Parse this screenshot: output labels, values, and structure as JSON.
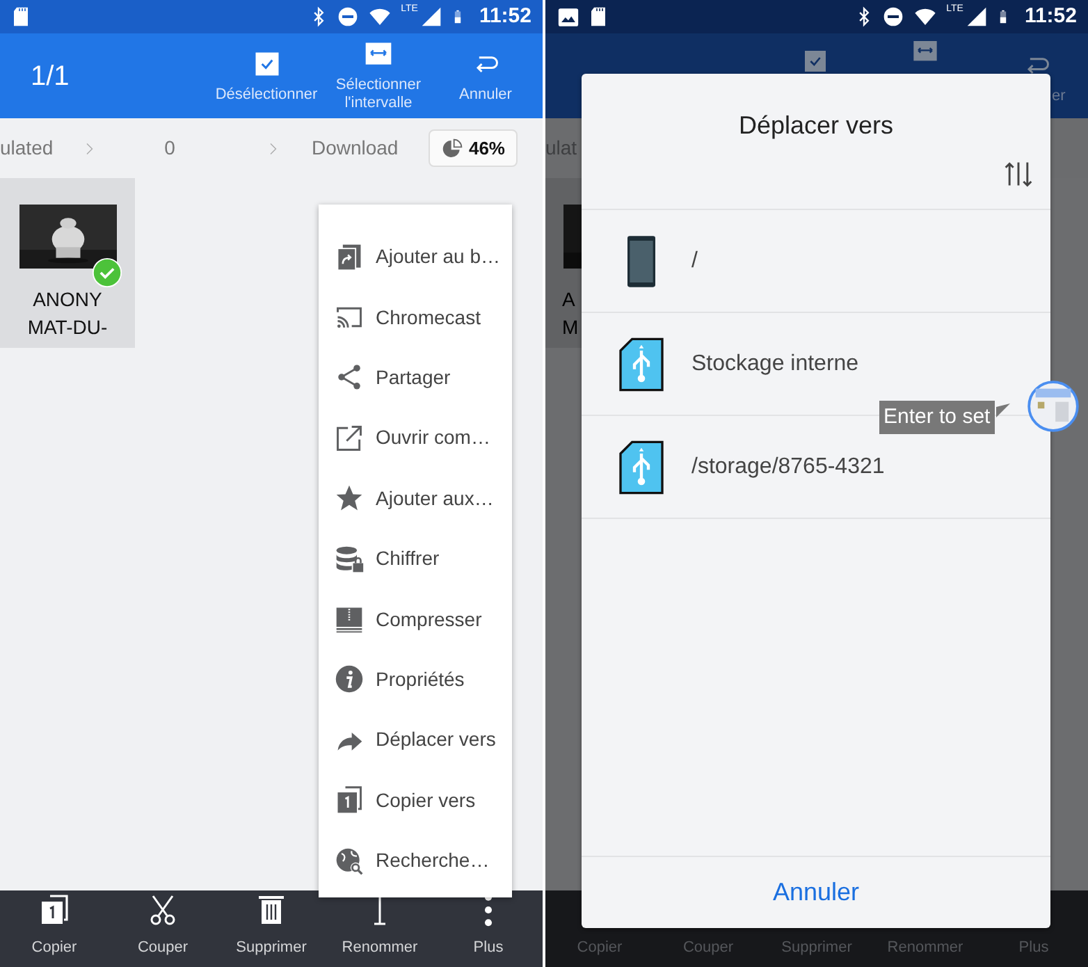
{
  "left_screen": {
    "status_bar": {
      "network": "LTE",
      "time": "11:52"
    },
    "app_bar": {
      "count": "1/1",
      "actions": [
        {
          "kind": "check",
          "label": "Désélectionner"
        },
        {
          "kind": "range",
          "label": "Sélectionner l'intervalle"
        },
        {
          "kind": "undo",
          "label": "Annuler"
        }
      ]
    },
    "breadcrumb": [
      {
        "label": "ulated"
      },
      {
        "label": "0"
      },
      {
        "label": "Download"
      }
    ],
    "storage": {
      "percent": "46%"
    },
    "files": [
      {
        "name_lines": [
          "ANONY",
          "MAT-DU-"
        ],
        "selected": true
      }
    ],
    "menu": [
      {
        "kind": "shortcut",
        "label": "Ajouter au b…"
      },
      {
        "kind": "cast",
        "label": "Chromecast"
      },
      {
        "kind": "share",
        "label": "Partager"
      },
      {
        "kind": "open",
        "label": "Ouvrir com…"
      },
      {
        "kind": "star",
        "label": "Ajouter aux…"
      },
      {
        "kind": "encrypt",
        "label": "Chiffrer"
      },
      {
        "kind": "compress",
        "label": "Compresser"
      },
      {
        "kind": "info",
        "label": "Propriétés"
      },
      {
        "kind": "move",
        "label": "Déplacer vers"
      },
      {
        "kind": "copy",
        "label": "Copier vers"
      },
      {
        "kind": "search",
        "label": "Recherche…"
      }
    ],
    "bottom_bar": [
      {
        "kind": "copy",
        "label": "Copier"
      },
      {
        "kind": "cut",
        "label": "Couper"
      },
      {
        "kind": "delete",
        "label": "Supprimer"
      },
      {
        "kind": "rename",
        "label": "Renommer"
      },
      {
        "kind": "more",
        "label": "Plus"
      }
    ]
  },
  "right_screen": {
    "status_bar": {
      "network": "LTE",
      "time": "11:52"
    },
    "background": {
      "app_bar_fragment": "er",
      "breadcrumb_fragment": "ulat",
      "file_fragment": [
        "A",
        "M"
      ],
      "bottom_bar": [
        "Copier",
        "Couper",
        "Supprimer",
        "Renommer",
        "Plus"
      ]
    },
    "dialog": {
      "title": "Déplacer vers",
      "locations": [
        {
          "kind": "phone",
          "label": "/"
        },
        {
          "kind": "usb",
          "label": "Stockage interne"
        },
        {
          "kind": "usb",
          "label": "/storage/8765-4321"
        }
      ],
      "cancel": "Annuler"
    },
    "tooltip": "Enter to set"
  }
}
